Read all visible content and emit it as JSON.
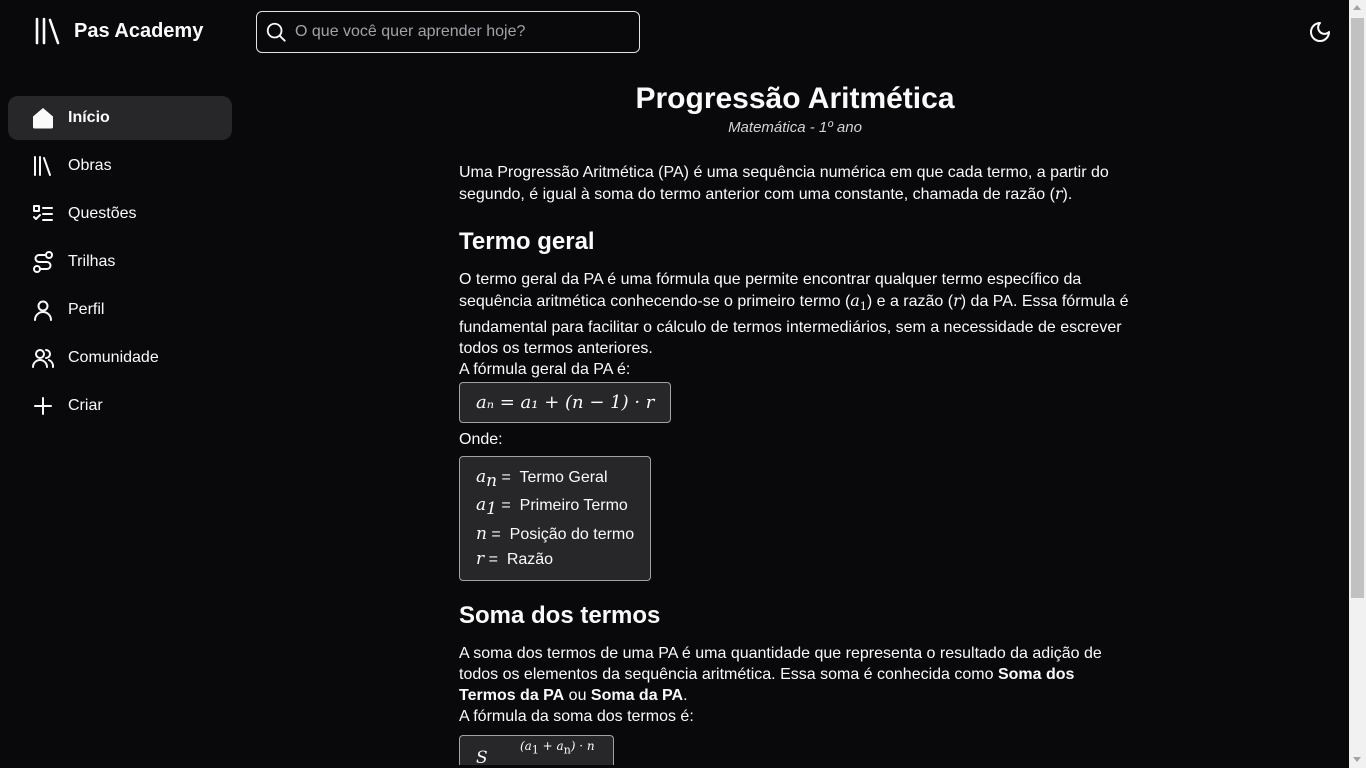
{
  "app": {
    "name": "Pas Academy"
  },
  "search": {
    "placeholder": "O que você quer aprender hoje?"
  },
  "sidebar": {
    "items": [
      {
        "label": "Início",
        "icon": "home-icon",
        "active": true
      },
      {
        "label": "Obras",
        "icon": "library-icon"
      },
      {
        "label": "Questões",
        "icon": "list-checks-icon"
      },
      {
        "label": "Trilhas",
        "icon": "route-icon"
      },
      {
        "label": "Perfil",
        "icon": "user-icon"
      },
      {
        "label": "Comunidade",
        "icon": "users-icon"
      },
      {
        "label": "Criar",
        "icon": "plus-icon"
      }
    ]
  },
  "article": {
    "title": "Progressão Aritmética",
    "subtitle": "Matemática - 1º ano",
    "intro_a": "Uma Progressão Aritmética (PA) é uma sequência numérica em que cada termo, a partir do segundo, é igual à soma do termo anterior com uma constante, chamada de razão (",
    "intro_r": "r",
    "intro_b": ").",
    "section1": {
      "heading": "Termo geral",
      "p1_a": "O termo geral da PA é uma fórmula que permite encontrar qualquer termo específico da sequência aritmética conhecendo-se o primeiro termo (",
      "p1_b": ") e a razão (",
      "p1_c": ") da PA. Essa fórmula é fundamental para facilitar o cálculo de termos intermediários, sem a necessidade de escrever todos os termos anteriores.",
      "p2": "A fórmula geral da PA é:",
      "formula": "aₙ = a₁ + (n − 1) · r",
      "onde": "Onde:",
      "defs": [
        {
          "sym": "a",
          "sub": "n",
          "desc": "Termo Geral"
        },
        {
          "sym": "a",
          "sub": "1",
          "desc": "Primeiro Termo"
        },
        {
          "sym": "n",
          "sub": "",
          "desc": "Posição do termo"
        },
        {
          "sym": "r",
          "sub": "",
          "desc": "Razão"
        }
      ]
    },
    "section2": {
      "heading": "Soma dos termos",
      "p1_a": "A soma dos termos de uma PA é uma quantidade que representa o resultado da adição de todos os elementos da sequência aritmética. Essa soma é conhecida como ",
      "p1_b1": "Soma dos Termos da PA",
      "p1_c": " ou ",
      "p1_b2": "Soma da PA",
      "p1_d": ".",
      "p2": "A fórmula da soma dos termos é:"
    }
  },
  "colors": {
    "background": "#09090b",
    "surface": "#27272a",
    "text": "#fafafa",
    "muted": "#a1a1aa"
  }
}
